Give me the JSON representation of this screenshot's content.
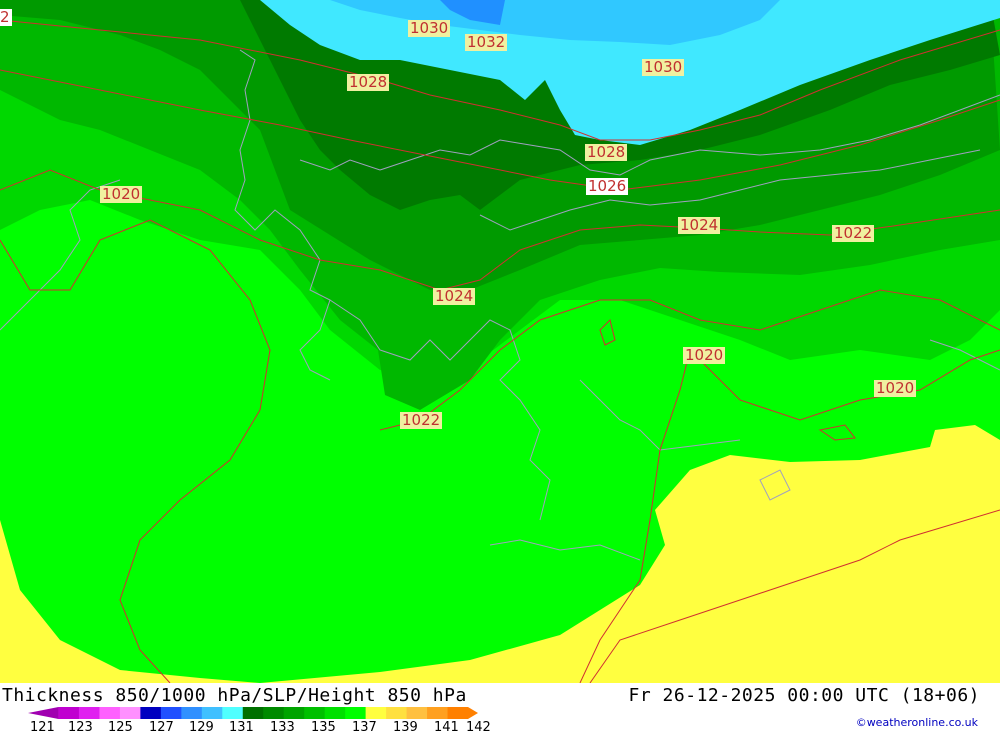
{
  "map": {
    "isobar_labels": [
      "1030",
      "1032",
      "1030",
      "1028",
      "1028",
      "1026",
      "1024",
      "1022",
      "1020",
      "1024",
      "1020",
      "1020",
      "1022",
      "2"
    ],
    "colors": {
      "lightgreen": "#00ff00",
      "green2": "#00d800",
      "green3": "#00b800",
      "green4": "#009a00",
      "darkgreen": "#007a00",
      "cyan": "#40e8ff",
      "lightblue": "#30c8ff",
      "blue": "#2090ff",
      "yellow": "#ffff40",
      "isobar": "#d03030",
      "coast": "#a0a0c0"
    }
  },
  "footer": {
    "title": "Thickness 850/1000 hPa/SLP/Height 850 hPa",
    "valid_time": "Fr 26-12-2025 00:00 UTC (18+06)",
    "credit": "©weatheronline.co.uk",
    "scale_ticks": [
      "121",
      "123",
      "125",
      "127",
      "129",
      "131",
      "133",
      "135",
      "137",
      "139",
      "141",
      "142"
    ],
    "scale_colors": [
      "#a000b0",
      "#c000d0",
      "#e020f0",
      "#ff60ff",
      "#ff90ff",
      "#0000c0",
      "#2050ff",
      "#3090ff",
      "#40c0ff",
      "#50ffff",
      "#007000",
      "#008a00",
      "#00a400",
      "#00c000",
      "#00e000",
      "#00ff00",
      "#ffff40",
      "#ffe040",
      "#ffc040",
      "#ffa020",
      "#ff8000"
    ]
  }
}
